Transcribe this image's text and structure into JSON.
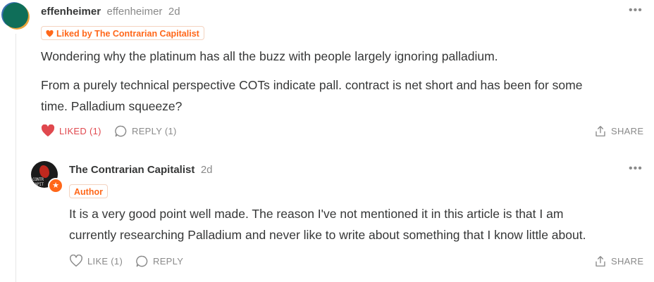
{
  "comments": [
    {
      "author": "effenheimer",
      "handle": "effenheimer",
      "time": "2d",
      "badge": "Liked by The Contrarian Capitalist",
      "paragraphs": [
        "Wondering why the platinum has all the buzz with people largely ignoring palladium.",
        "From a purely technical perspective COTs indicate pall. contract is net short and has been for some",
        "time. Palladium squeeze?"
      ],
      "actions": {
        "like": "LIKED (1)",
        "reply": "REPLY (1)",
        "share": "SHARE"
      }
    },
    {
      "author": "The Contrarian Capitalist",
      "time": "2d",
      "badge": "Author",
      "paragraphs": [
        "It is a very good point well made. The reason I've not mentioned it in this article is that I am",
        "currently researching Palladium and never like to write about something that I know little about."
      ],
      "actions": {
        "like": "LIKE (1)",
        "reply": "REPLY",
        "share": "SHARE"
      }
    }
  ],
  "icons": {
    "more": "more-options-icon",
    "heart_filled": "heart-filled-icon",
    "heart_outline": "heart-outline-icon",
    "reply": "speech-bubble-icon",
    "share": "share-icon"
  },
  "colors": {
    "accent": "#ff6719",
    "liked": "#e0484e",
    "muted": "#8a8a8a",
    "text": "#363737"
  },
  "avatar_text": "CONTRARIAN CAPITALIST"
}
